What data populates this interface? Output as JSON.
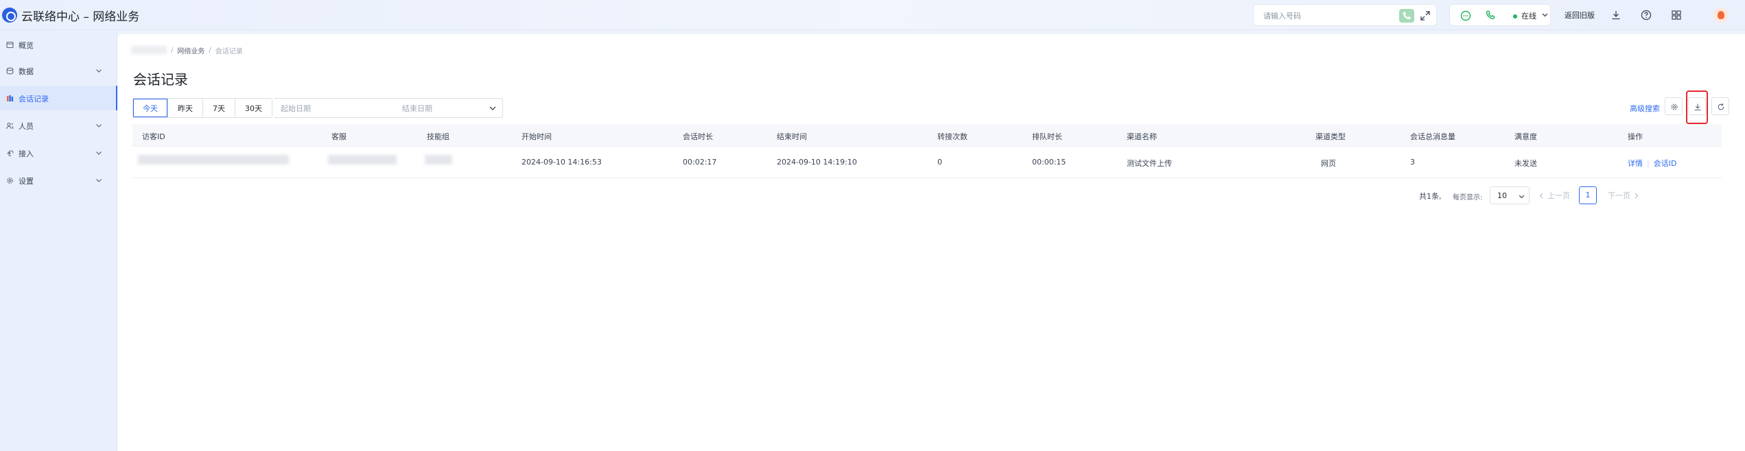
{
  "header": {
    "title": "云联络中心 – 网络业务",
    "dial_placeholder": "请输入号码",
    "status_label": "在线",
    "back_old_label": "返回旧版"
  },
  "sidebar": {
    "items": [
      {
        "label": "概览",
        "icon": "overview-icon"
      },
      {
        "label": "数据",
        "icon": "data-icon"
      },
      {
        "label": "会话记录",
        "icon": "records-icon",
        "active": true
      },
      {
        "label": "人员",
        "icon": "people-icon"
      },
      {
        "label": "接入",
        "icon": "access-icon"
      },
      {
        "label": "设置",
        "icon": "settings-icon"
      }
    ]
  },
  "breadcrumb": {
    "middle": "网络业务",
    "current": "会话记录"
  },
  "page_title": "会话记录",
  "filters": {
    "quick": [
      "今天",
      "昨天",
      "7天",
      "30天"
    ],
    "start_placeholder": "起始日期",
    "end_placeholder": "结束日期",
    "advanced_search": "高级搜索"
  },
  "table": {
    "columns": [
      "访客ID",
      "客服",
      "技能组",
      "开始时间",
      "会话时长",
      "结束时间",
      "转接次数",
      "排队时长",
      "渠道名称",
      "渠道类型",
      "会话总消息量",
      "满意度",
      "操作"
    ],
    "rows": [
      {
        "start_time": "2024-09-10 14:16:53",
        "duration": "00:02:17",
        "end_time": "2024-09-10 14:19:10",
        "transfers": "0",
        "queue_time": "00:00:15",
        "channel_name": "测试文件上传",
        "channel_type": "网页",
        "message_count": "3",
        "satisfaction": "未发送",
        "op_detail": "详情",
        "op_session_id": "会话ID"
      }
    ]
  },
  "pagination": {
    "total": "共1条,",
    "page_size_label": "每页显示:",
    "page_size": "10",
    "prev": "上一页",
    "current_page": "1",
    "next": "下一页"
  },
  "colors": {
    "accent": "#2f6bf0",
    "online": "#20b45a",
    "highlight": "#e3262d"
  }
}
